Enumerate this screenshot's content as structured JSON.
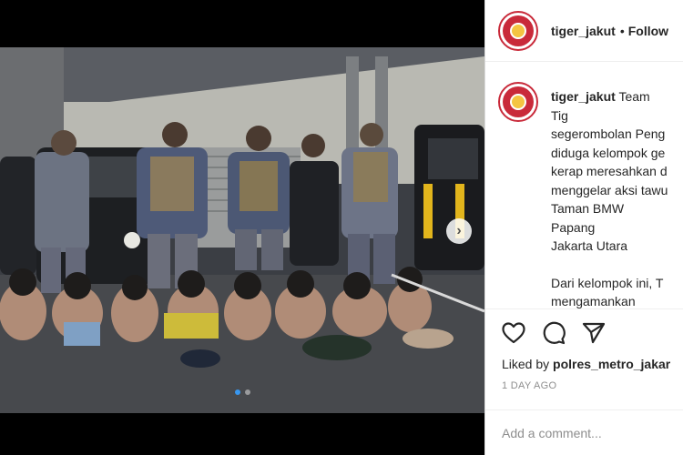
{
  "post": {
    "username": "tiger_jakut",
    "follow_separator": "•",
    "follow_label": "Follow",
    "caption_line1": "Team Tig",
    "caption_rest": "segerombolan Peng\ndiduga kelompok ge\nkerap meresahkan d\nmenggelar aksi tawu\nTaman BMW Papang\nJakarta Utara",
    "caption_para2": "Dari kelompok ini, T\nmengamankan sejum\nyang dibawa",
    "liked_prefix": "Liked by",
    "liked_user": "polres_metro_jakar",
    "time_ago": "1 DAY AGO",
    "add_comment_placeholder": "Add a comment..."
  },
  "carousel": {
    "total": 2,
    "active_index": 0
  },
  "icons": {
    "like": "heart-icon",
    "comment": "comment-icon",
    "share": "send-icon",
    "next": "chevron-right-icon"
  },
  "colors": {
    "avatar_ring": "#c92a3a",
    "active_dot": "#3897f0",
    "text": "#262626",
    "muted": "#8e8e8e"
  }
}
